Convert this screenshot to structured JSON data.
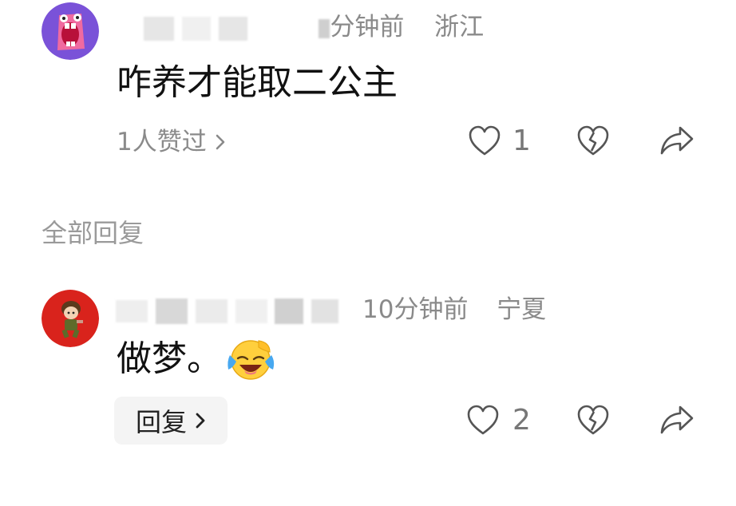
{
  "comment": {
    "time_partial": "分钟前",
    "location": "浙江",
    "text": "咋养才能取二公主",
    "likes_text": "1人赞过",
    "like_count": "1"
  },
  "section_title": "全部回复",
  "reply": {
    "time": "10分钟前",
    "location": "宁夏",
    "text": "做梦。",
    "reply_label": "回复",
    "like_count": "2"
  },
  "icons": {
    "like": "heart-outline-icon",
    "dislike": "broken-heart-icon",
    "share": "share-arrow-icon",
    "chevron": "chevron-right-icon",
    "emoji": "laughing-crying-emoji-icon"
  },
  "colors": {
    "meta_gray": "#8a8a8a",
    "avatar1_bg": "#7a52d8",
    "avatar2_bg": "#d9231c"
  }
}
